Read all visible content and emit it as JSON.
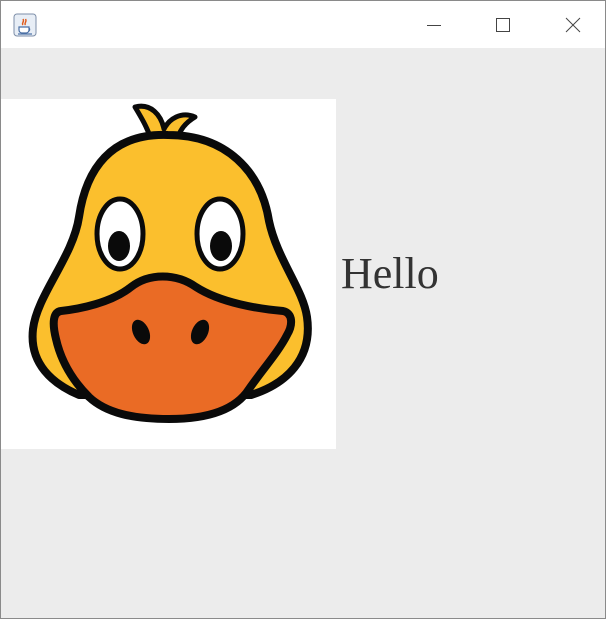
{
  "window": {
    "icon": "java-coffee-cup-icon",
    "controls": {
      "minimize_icon": "minimize-icon",
      "maximize_icon": "maximize-icon",
      "close_icon": "close-icon"
    }
  },
  "content": {
    "image": {
      "icon": "duck-face-icon",
      "colors": {
        "face": "#FBBF2D",
        "beak": "#EA6B25",
        "outline": "#0a0a0a"
      }
    },
    "label": "Hello"
  }
}
